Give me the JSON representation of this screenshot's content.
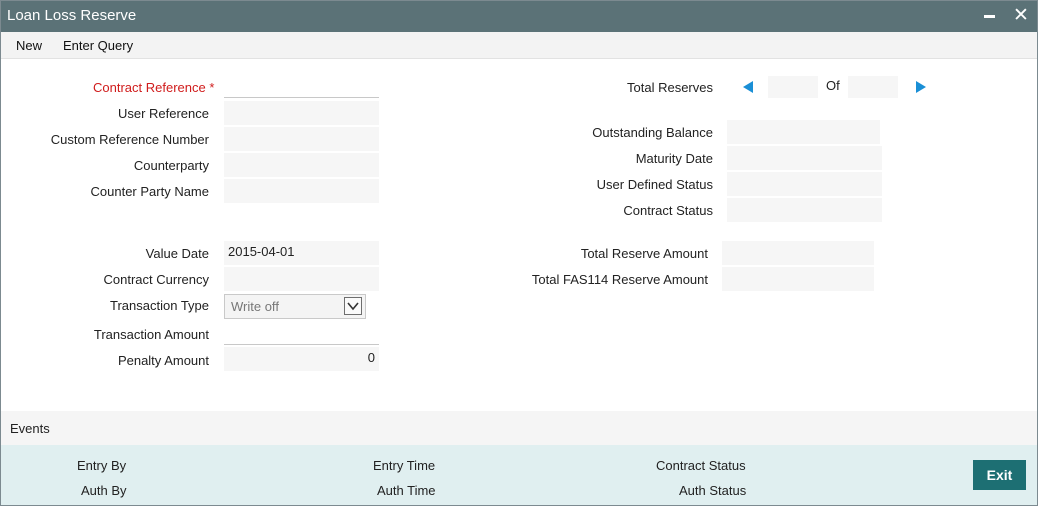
{
  "window": {
    "title": "Loan Loss Reserve"
  },
  "menu": {
    "new_label": "New",
    "enter_query_label": "Enter Query"
  },
  "form": {
    "contract_reference": {
      "label": "Contract Reference",
      "required_marker": "*",
      "value": ""
    },
    "user_reference": {
      "label": "User Reference",
      "value": ""
    },
    "custom_reference_number": {
      "label": "Custom Reference Number",
      "value": ""
    },
    "counterparty": {
      "label": "Counterparty",
      "value": ""
    },
    "counter_party_name": {
      "label": "Counter Party Name",
      "value": ""
    },
    "value_date": {
      "label": "Value Date",
      "value": "2015-04-01"
    },
    "contract_currency": {
      "label": "Contract Currency",
      "value": ""
    },
    "transaction_type": {
      "label": "Transaction Type",
      "value": "Write off"
    },
    "transaction_amount": {
      "label": "Transaction Amount",
      "value": ""
    },
    "penalty_amount": {
      "label": "Penalty Amount",
      "value": "0"
    },
    "total_reserves": {
      "label": "Total Reserves",
      "current": "",
      "of_label": "Of",
      "total": ""
    },
    "outstanding_balance": {
      "label": "Outstanding Balance",
      "value": ""
    },
    "maturity_date": {
      "label": "Maturity Date",
      "value": ""
    },
    "user_defined_status": {
      "label": "User Defined Status",
      "value": ""
    },
    "contract_status": {
      "label": "Contract Status",
      "value": ""
    },
    "total_reserve_amount": {
      "label": "Total Reserve Amount",
      "value": ""
    },
    "total_fas114_reserve_amount": {
      "label": "Total FAS114 Reserve Amount",
      "value": ""
    }
  },
  "events": {
    "label": "Events"
  },
  "footer": {
    "entry_by": "Entry By",
    "auth_by": "Auth By",
    "entry_time": "Entry Time",
    "auth_time": "Auth Time",
    "contract_status": "Contract Status",
    "auth_status": "Auth Status",
    "exit_label": "Exit"
  },
  "icons": {
    "minimize": "minimize-icon",
    "close": "close-icon",
    "prev": "arrow-left-icon",
    "next": "arrow-right-icon",
    "dropdown": "chevron-down-icon"
  },
  "colors": {
    "titlebar": "#5b7277",
    "required": "#d01c1c",
    "nav_arrow": "#1a8fd6",
    "footer": "#e0eff0",
    "exit_button": "#1d6f73"
  }
}
